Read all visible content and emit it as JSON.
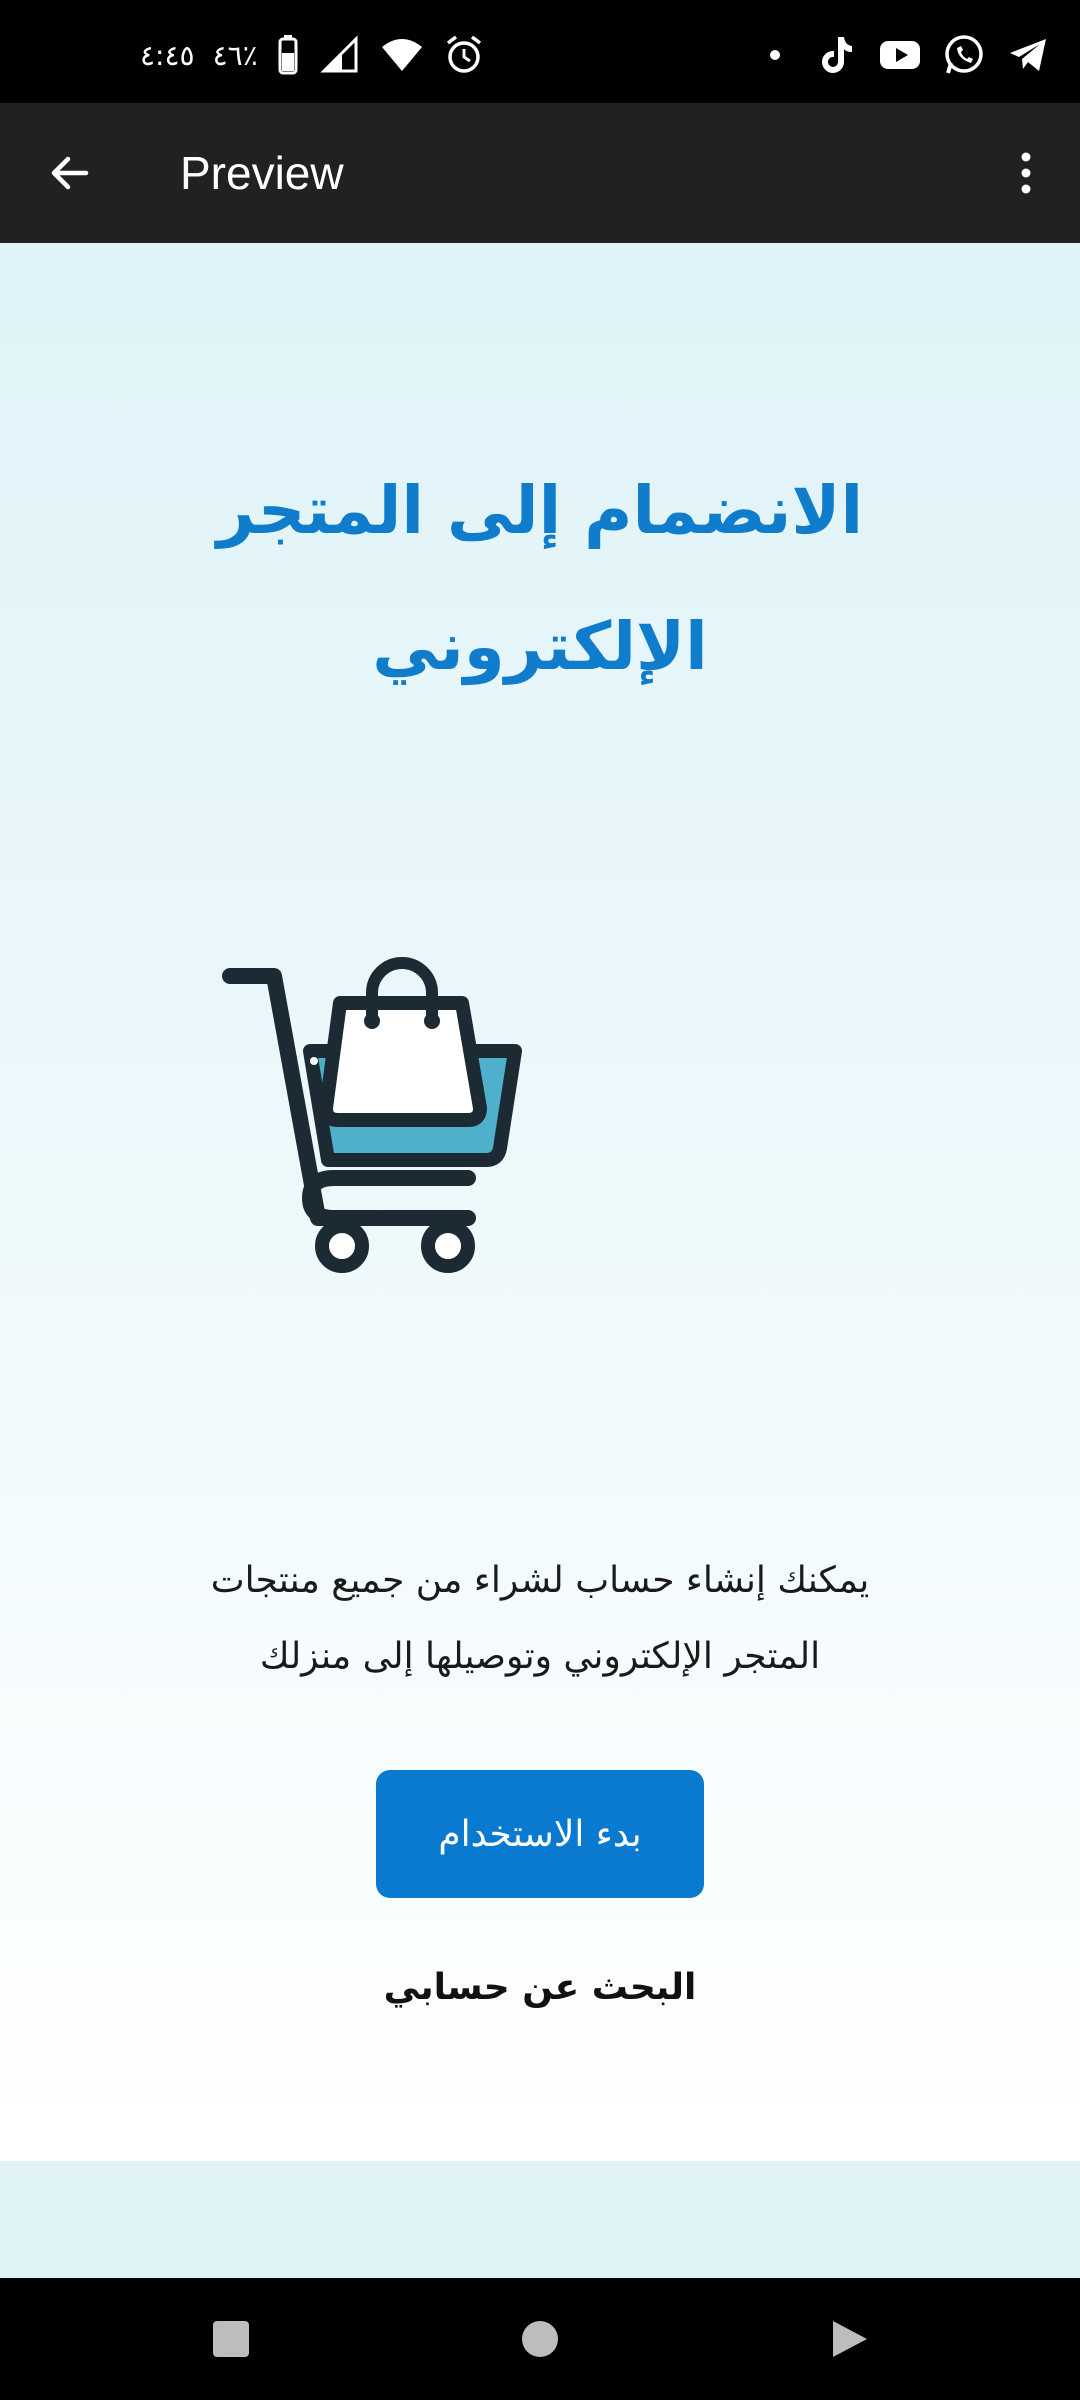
{
  "status_bar": {
    "time": "٤:٤٥",
    "battery": "٤٦٪",
    "icons": [
      "battery-icon",
      "signal-icon",
      "wifi-icon",
      "alarm-icon",
      "notification-dot-icon",
      "tiktok-icon",
      "youtube-icon",
      "whatsapp-icon",
      "telegram-icon"
    ]
  },
  "toolbar": {
    "title": "Preview",
    "back_icon": "arrow-back-icon",
    "menu_icon": "more-vert-icon"
  },
  "content": {
    "heading_line1": "الانضمام إلى المتجر",
    "heading_line2": "الإلكتروني",
    "illustration": "shopping-cart-icon",
    "description_line1": "يمكنك إنشاء حساب لشراء من جميع منتجات",
    "description_line2": "المتجر الإلكتروني وتوصيلها إلى منزلك",
    "start_button_label": "بدء الاستخدام",
    "find_account_label": "البحث عن حسابي"
  },
  "nav_bar": {
    "icons": [
      "recent-apps-icon",
      "home-icon",
      "back-triangle-icon"
    ]
  },
  "colors": {
    "accent": "#0f7ccc",
    "button": "#0a7ad0",
    "toolbar": "#212121",
    "cart_fill": "#4fb0cb"
  }
}
